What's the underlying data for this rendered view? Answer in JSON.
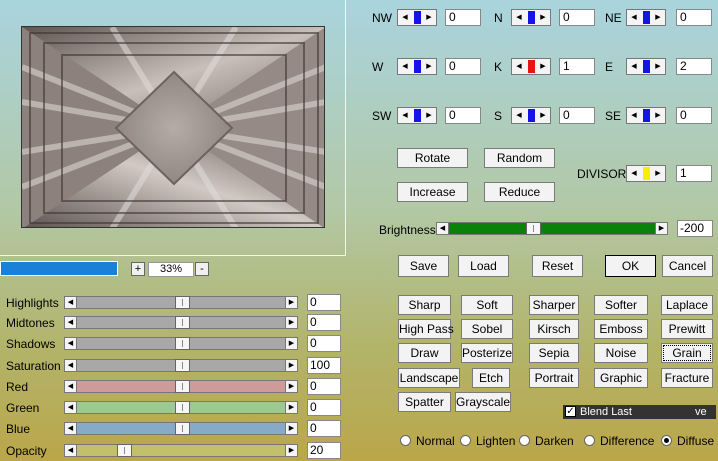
{
  "zoom": {
    "value": "33%",
    "plus": "+",
    "minus": "-",
    "progress": 1.0
  },
  "sliders": [
    {
      "label": "Highlights",
      "value": "0",
      "position": 0.5,
      "color": "#a8a8a8"
    },
    {
      "label": "Midtones",
      "value": "0",
      "position": 0.5,
      "color": "#a8a8a8"
    },
    {
      "label": "Shadows",
      "value": "0",
      "position": 0.5,
      "color": "#a8a8a8"
    },
    {
      "label": "Saturation",
      "value": "100",
      "position": 0.5,
      "color": "#a8a8a8"
    },
    {
      "label": "Red",
      "value": "0",
      "position": 0.5,
      "color": "#cf9a9a"
    },
    {
      "label": "Green",
      "value": "0",
      "position": 0.5,
      "color": "#9cc992"
    },
    {
      "label": "Blue",
      "value": "0",
      "position": 0.5,
      "color": "#86aac8"
    },
    {
      "label": "Opacity",
      "value": "20",
      "position": 0.2,
      "color": "#c2c069"
    }
  ],
  "matrix": [
    {
      "label": "NW",
      "value": "0"
    },
    {
      "label": "N",
      "value": "0"
    },
    {
      "label": "NE",
      "value": "0"
    },
    {
      "label": "W",
      "value": "0"
    },
    {
      "label": "K",
      "value": "1"
    },
    {
      "label": "E",
      "value": "2"
    },
    {
      "label": "SW",
      "value": "0"
    },
    {
      "label": "S",
      "value": "0"
    },
    {
      "label": "SE",
      "value": "0"
    }
  ],
  "matrix_colors": {
    "normal": "#1414e6",
    "center": "#e61414",
    "divisor": "#f2f200"
  },
  "buttons": {
    "rotate": "Rotate",
    "random": "Random",
    "increase": "Increase",
    "reduce": "Reduce"
  },
  "divisor": {
    "label": "DIVISOR",
    "value": "1"
  },
  "brightness": {
    "label": "Brightness",
    "value": "-200",
    "position": 0.4,
    "color": "#0a820a"
  },
  "actions": {
    "save": "Save",
    "load": "Load",
    "reset": "Reset",
    "ok": "OK",
    "cancel": "Cancel"
  },
  "presets": [
    [
      "Sharp",
      "Soft",
      "Sharper",
      "Softer",
      "Laplace"
    ],
    [
      "High Pass",
      "Sobel",
      "Kirsch",
      "Emboss",
      "Prewitt"
    ],
    [
      "Draw",
      "Posterize",
      "Sepia",
      "Noise",
      "Grain"
    ],
    [
      "Landscape",
      "Etch",
      "Portrait",
      "Graphic",
      "Fracture"
    ],
    [
      "Spatter",
      "Grayscale"
    ]
  ],
  "blend_last": {
    "label": "Blend Last",
    "tail": "ve",
    "checked": true
  },
  "blend_modes": [
    {
      "label": "Normal",
      "selected": false
    },
    {
      "label": "Lighten",
      "selected": false
    },
    {
      "label": "Darken",
      "selected": false
    },
    {
      "label": "Difference",
      "selected": false
    },
    {
      "label": "Diffuse",
      "selected": true
    }
  ]
}
